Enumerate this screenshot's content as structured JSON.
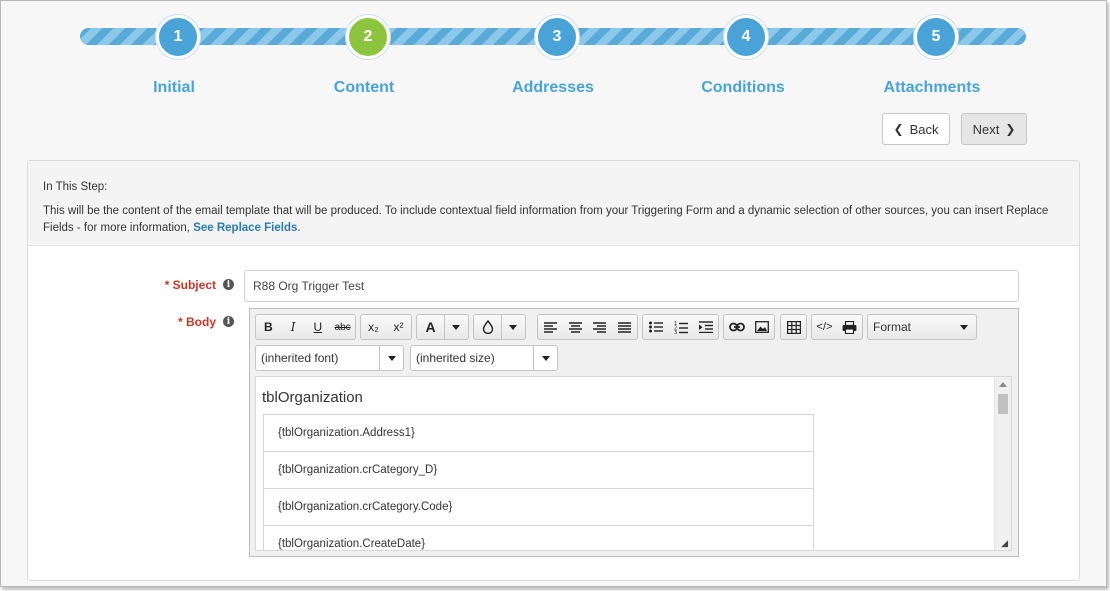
{
  "wizard": {
    "steps": [
      {
        "number": "1",
        "label": "Initial"
      },
      {
        "number": "2",
        "label": "Content"
      },
      {
        "number": "3",
        "label": "Addresses"
      },
      {
        "number": "4",
        "label": "Conditions"
      },
      {
        "number": "5",
        "label": "Attachments"
      }
    ],
    "active_step": 2,
    "colors": {
      "step": "#4aa3d6",
      "active": "#8cc43f"
    }
  },
  "nav": {
    "back_label": "Back",
    "next_label": "Next"
  },
  "info": {
    "title": "In This Step:",
    "text": "This will be the content of the email template that will be produced. To include contextual field information from your Triggering Form and a dynamic selection of other sources, you can insert Replace Fields - for more information, ",
    "link": "See Replace Fields",
    "suffix": "."
  },
  "form": {
    "subject_label": "* Subject",
    "subject_value": "R88 Org Trigger Test",
    "body_label": "* Body"
  },
  "editor": {
    "toolbar": {
      "bold": "B",
      "italic": "I",
      "underline": "U",
      "strike": "abc",
      "subscript": "x₂",
      "superscript": "x²",
      "font_color": "A",
      "format_label": "Format"
    },
    "font_select": "(inherited font)",
    "size_select": "(inherited size)",
    "content_title": "tblOrganization",
    "fields": [
      "{tblOrganization.Address1}",
      "{tblOrganization.crCategory_D}",
      "{tblOrganization.crCategory.Code}",
      "{tblOrganization.CreateDate}"
    ]
  }
}
